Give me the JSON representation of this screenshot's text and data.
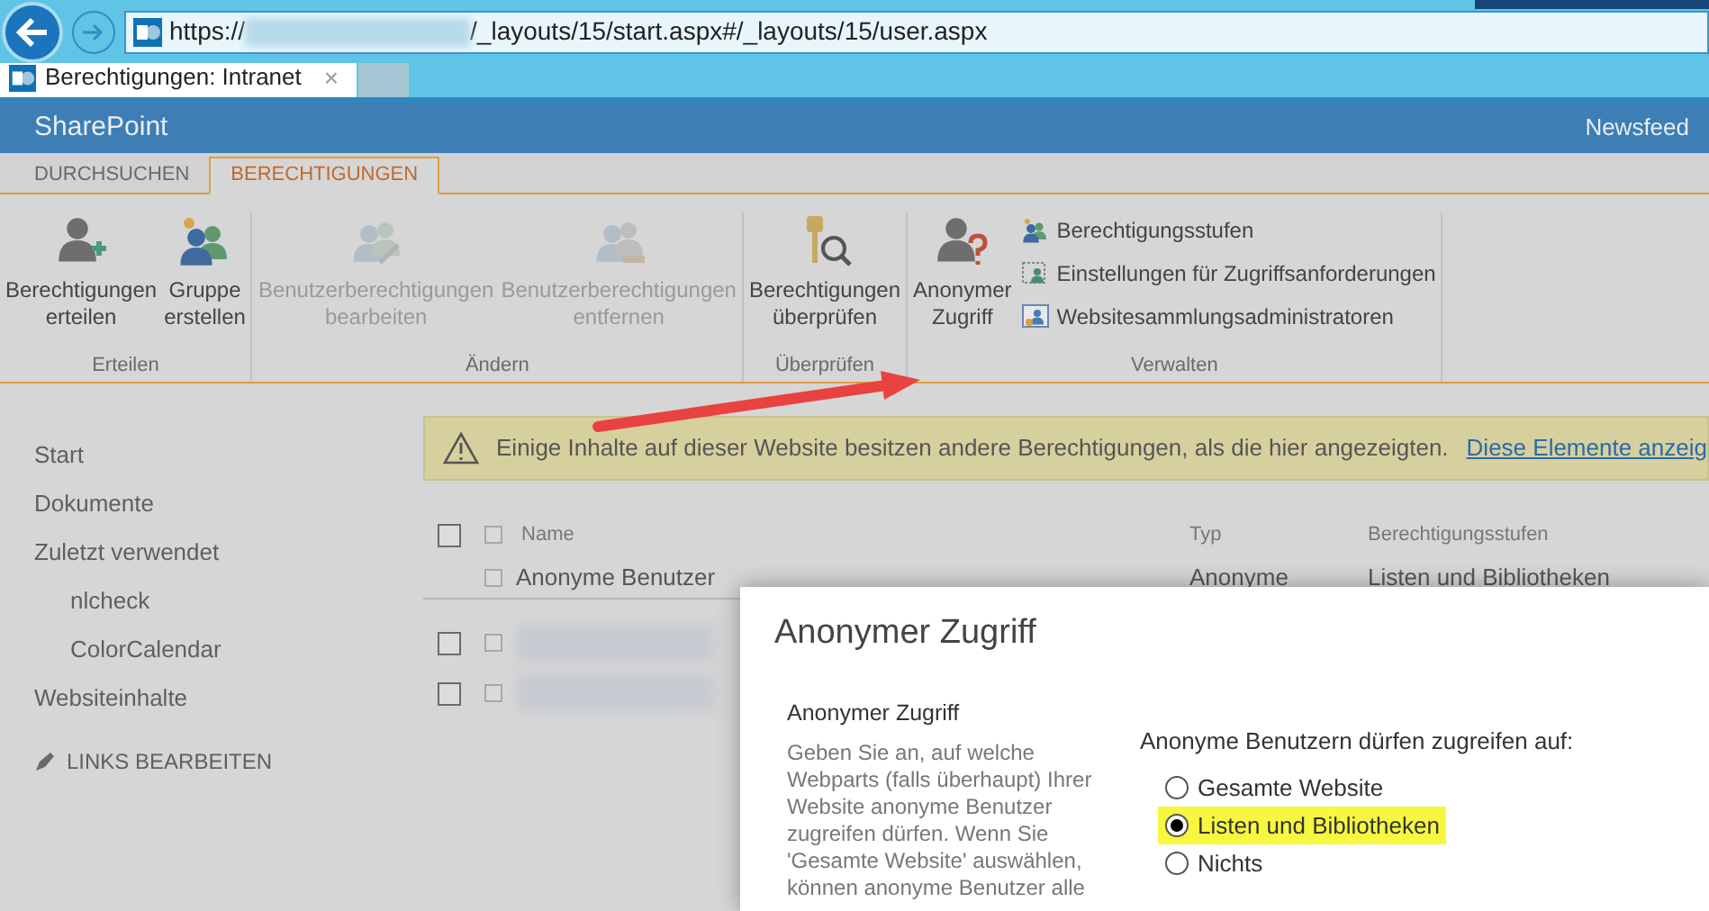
{
  "browser": {
    "url_scheme": "https://",
    "url_path": "/_layouts/15/start.aspx#/_layouts/15/user.aspx",
    "tabs": [
      {
        "title": "Berechtigungen: Intranet",
        "selected": true
      }
    ],
    "close_glyph": "×"
  },
  "suite_bar": {
    "brand": "SharePoint",
    "links": [
      "Newsfeed"
    ]
  },
  "ribbon": {
    "tabs": [
      {
        "label": "DURCHSUCHEN",
        "selected": false
      },
      {
        "label": "BERECHTIGUNGEN",
        "selected": true
      }
    ],
    "groups": [
      {
        "label": "Erteilen",
        "items": [
          {
            "kind": "large",
            "label": "Berechtigungen\nerteilen",
            "disabled": false
          },
          {
            "kind": "large",
            "label": "Gruppe\nerstellen",
            "disabled": false
          }
        ]
      },
      {
        "label": "Ändern",
        "items": [
          {
            "kind": "large",
            "label": "Benutzerberechtigungen\nbearbeiten",
            "disabled": true
          },
          {
            "kind": "large",
            "label": "Benutzerberechtigungen\nentfernen",
            "disabled": true
          }
        ]
      },
      {
        "label": "Überprüfen",
        "items": [
          {
            "kind": "large",
            "label": "Berechtigungen\nüberprüfen",
            "disabled": false
          }
        ]
      },
      {
        "label": "Verwalten",
        "items": [
          {
            "kind": "large",
            "label": "Anonymer\nZugriff",
            "disabled": false
          },
          {
            "kind": "small",
            "label": "Berechtigungsstufen",
            "disabled": false
          },
          {
            "kind": "small",
            "label": "Einstellungen für Zugriffsanforderungen",
            "disabled": false
          },
          {
            "kind": "small",
            "label": "Websitesammlungsadministratoren",
            "disabled": false
          }
        ]
      }
    ]
  },
  "sidebar": {
    "items": [
      {
        "label": "Start"
      },
      {
        "label": "Dokumente"
      },
      {
        "label": "Zuletzt verwendet",
        "children": [
          {
            "label": "nlcheck"
          },
          {
            "label": "ColorCalendar"
          }
        ]
      },
      {
        "label": "Websiteinhalte"
      }
    ],
    "edit_links": "LINKS BEARBEITEN"
  },
  "notice": {
    "text": "Einige Inhalte auf dieser Website besitzen andere Berechtigungen, als die hier angezeigten.",
    "link": "Diese Elemente anzeig"
  },
  "table": {
    "columns": [
      "Name",
      "Typ",
      "Berechtigungsstufen"
    ],
    "select_all_checked": false,
    "group_header_checked": false,
    "rows": [
      {
        "kind": "group",
        "checked": false,
        "cells": [
          "Anonyme Benutzer",
          "Anonyme",
          "Listen und Bibliotheken"
        ]
      },
      {
        "kind": "redacted",
        "checked": false,
        "inner_checked": false
      },
      {
        "kind": "redacted",
        "checked": false,
        "inner_checked": false
      }
    ]
  },
  "dialog": {
    "title": "Anonymer Zugriff",
    "section_heading": "Anonymer Zugriff",
    "section_description": "Geben Sie an, auf welche Webparts (falls überhaupt) Ihrer Website anonyme Benutzer zugreifen dürfen. Wenn Sie 'Gesamte Website' auswählen, können anonyme Benutzer alle",
    "question": "Anonyme Benutzern dürfen zugreifen auf:",
    "options": [
      {
        "label": "Gesamte Website",
        "selected": false
      },
      {
        "label": "Listen und Bibliotheken",
        "selected": true
      },
      {
        "label": "Nichts",
        "selected": false
      }
    ]
  }
}
